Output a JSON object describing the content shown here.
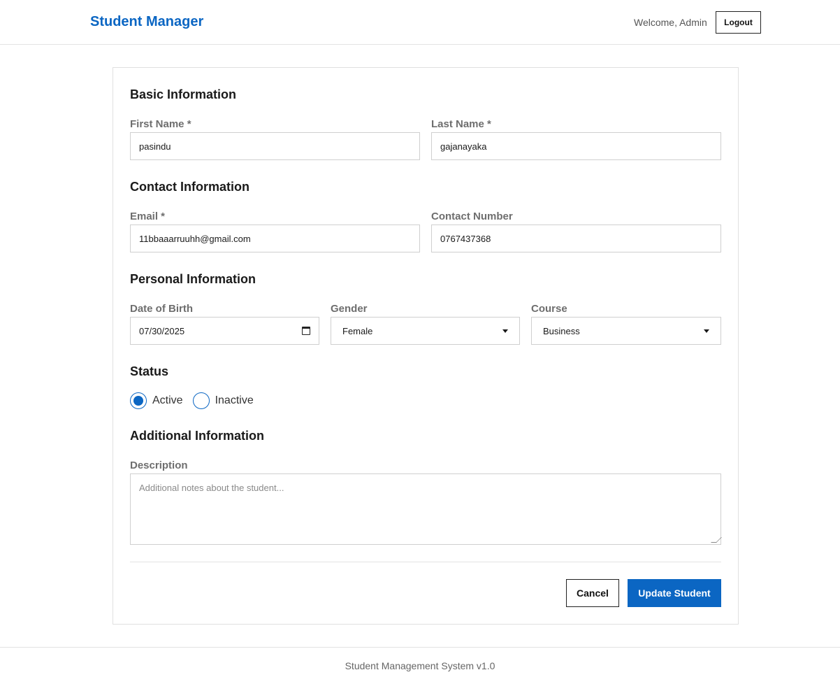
{
  "header": {
    "brand": "Student Manager",
    "welcome": "Welcome, Admin",
    "logout_label": "Logout"
  },
  "form": {
    "basic": {
      "title": "Basic Information",
      "first_name_label": "First Name *",
      "first_name_value": "pasindu",
      "last_name_label": "Last Name *",
      "last_name_value": "gajanayaka"
    },
    "contact": {
      "title": "Contact Information",
      "email_label": "Email *",
      "email_value": "11bbaaarruuhh@gmail.com",
      "phone_label": "Contact Number",
      "phone_value": "0767437368"
    },
    "personal": {
      "title": "Personal Information",
      "dob_label": "Date of Birth",
      "dob_value": "07/30/2025",
      "gender_label": "Gender",
      "gender_value": "Female",
      "course_label": "Course",
      "course_value": "Business"
    },
    "status": {
      "title": "Status",
      "options": [
        {
          "label": "Active",
          "checked": true
        },
        {
          "label": "Inactive",
          "checked": false
        }
      ]
    },
    "additional": {
      "title": "Additional Information",
      "description_label": "Description",
      "description_placeholder": "Additional notes about the student..."
    },
    "actions": {
      "cancel_label": "Cancel",
      "submit_label": "Update Student"
    }
  },
  "footer": {
    "text": "Student Management System v1.0"
  },
  "colors": {
    "accent": "#0b66c3"
  }
}
